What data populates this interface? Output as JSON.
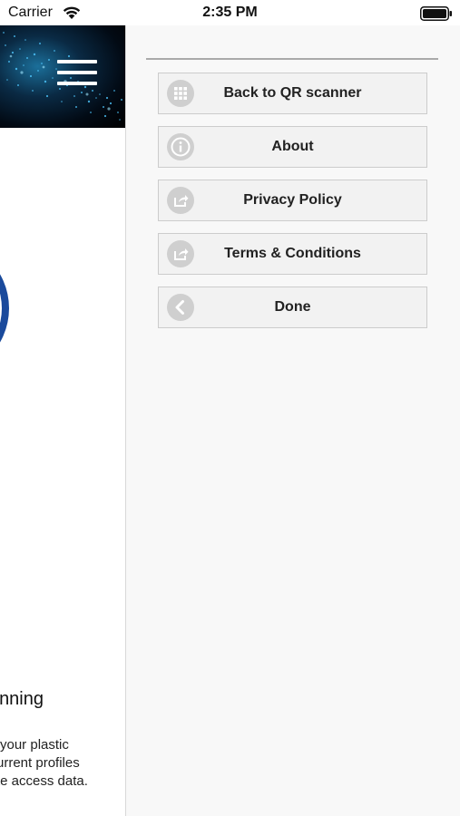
{
  "status_bar": {
    "carrier": "Carrier",
    "time": "2:35 PM",
    "wifi_icon": "wifi-icon",
    "battery_icon": "battery-full-icon"
  },
  "content_page": {
    "heading_fragment": "nning",
    "body_lines": [
      "your plastic",
      "urrent profiles",
      "te access data."
    ],
    "colors": {
      "banner": "#0a2a44",
      "logo_ring": "#1a4a9c"
    }
  },
  "side_menu": {
    "items": [
      {
        "label": "Back to QR scanner",
        "icon": "grid-icon"
      },
      {
        "label": "About",
        "icon": "info-icon"
      },
      {
        "label": "Privacy Policy",
        "icon": "share-icon"
      },
      {
        "label": "Terms & Conditions",
        "icon": "share-icon"
      },
      {
        "label": "Done",
        "icon": "chevron-left-icon"
      }
    ],
    "colors": {
      "panel_bg": "#f8f8f8",
      "button_bg": "#f2f2f2",
      "icon_bg": "#cfcfcf"
    }
  }
}
